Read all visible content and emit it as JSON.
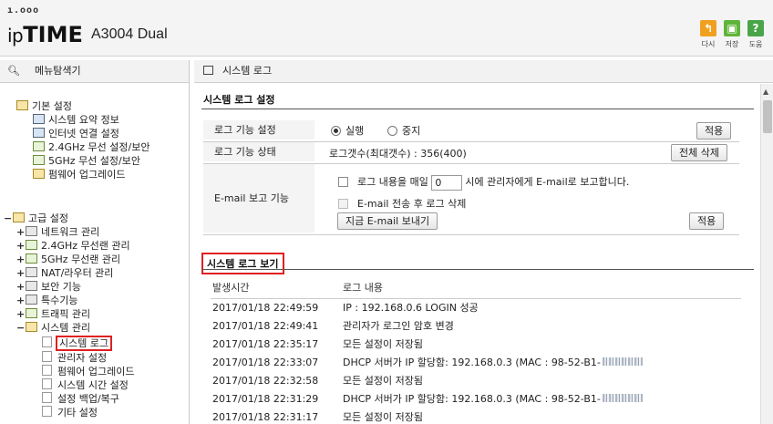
{
  "header": {
    "logo_dots": "ı.ooo",
    "brand_ip": "ip",
    "brand_time": "TIME",
    "model": "A3004 Dual",
    "tools": [
      {
        "label": "다시",
        "icon": "back-icon",
        "glyph": "↰",
        "color": "#f0a020"
      },
      {
        "label": "저장",
        "icon": "save-icon",
        "glyph": "▣",
        "color": "#5fb53a"
      },
      {
        "label": "도움",
        "icon": "help-icon",
        "glyph": "?",
        "color": "#4aa54a"
      }
    ]
  },
  "left": {
    "title": "메뉴탐색기",
    "basic": {
      "label": "기본 설정",
      "items": [
        {
          "label": "시스템 요약 정보",
          "icon": "summary-icon"
        },
        {
          "label": "인터넷 연결 설정",
          "icon": "internet-icon"
        },
        {
          "label": "2.4GHz 무선 설정/보안",
          "icon": "wifi-icon"
        },
        {
          "label": "5GHz 무선 설정/보안",
          "icon": "wifi-icon"
        },
        {
          "label": "펌웨어 업그레이드",
          "icon": "firmware-icon"
        }
      ]
    },
    "advanced": {
      "label": "고급 설정",
      "items": [
        {
          "label": "네트워크 관리",
          "prefix": "+"
        },
        {
          "label": "2.4GHz 무선랜 관리",
          "prefix": "+"
        },
        {
          "label": "5GHz 무선랜 관리",
          "prefix": "+"
        },
        {
          "label": "NAT/라우터 관리",
          "prefix": "+"
        },
        {
          "label": "보안 기능",
          "prefix": "+"
        },
        {
          "label": "특수기능",
          "prefix": "+"
        },
        {
          "label": "트래픽 관리",
          "prefix": "+"
        },
        {
          "label": "시스템 관리",
          "prefix": "−"
        }
      ],
      "system_children": [
        {
          "label": "시스템 로그",
          "selected": true
        },
        {
          "label": "관리자 설정"
        },
        {
          "label": "펌웨어 업그레이드"
        },
        {
          "label": "시스템 시간 설정"
        },
        {
          "label": "설정 백업/복구"
        },
        {
          "label": "기타 설정"
        }
      ]
    }
  },
  "main": {
    "title": "시스템 로그",
    "settings_heading": "시스템 로그 설정",
    "log_function_label": "로그 기능 설정",
    "radio_run": "실행",
    "radio_stop": "중지",
    "apply": "적용",
    "log_status_label": "로그 기능 상태",
    "log_status_value": "로그갯수(최대갯수) : 356(400)",
    "delete_all": "전체 삭제",
    "email_label": "E-mail 보고 기능",
    "email_daily_prefix": "로그 내용을 매일",
    "email_hour_value": "0",
    "email_daily_suffix": "시에 관리자에게 E-mail로 보고합니다.",
    "email_delete_after": "E-mail 전송 후 로그 삭제",
    "send_now": "지금 E-mail 보내기",
    "view_heading": "시스템 로그 보기",
    "col_time": "발생시간",
    "col_content": "로그 내용",
    "logs": [
      {
        "time": "2017/01/18 22:49:59",
        "msg": "IP : 192.168.0.6 LOGIN 성공",
        "smudge": false
      },
      {
        "time": "2017/01/18 22:49:41",
        "msg": "관리자가 로그인 암호 변경",
        "smudge": false
      },
      {
        "time": "2017/01/18 22:35:17",
        "msg": "모든 설정이 저장됨",
        "smudge": false
      },
      {
        "time": "2017/01/18 22:33:07",
        "msg": "DHCP 서버가 IP 할당함: 192.168.0.3 (MAC : 98-52-B1-",
        "smudge": true
      },
      {
        "time": "2017/01/18 22:32:58",
        "msg": "모든 설정이 저장됨",
        "smudge": false
      },
      {
        "time": "2017/01/18 22:31:29",
        "msg": "DHCP 서버가 IP 할당함: 192.168.0.3 (MAC : 98-52-B1-",
        "smudge": true
      },
      {
        "time": "2017/01/18 22:31:17",
        "msg": "모든 설정이 저장됨",
        "smudge": false
      }
    ]
  }
}
